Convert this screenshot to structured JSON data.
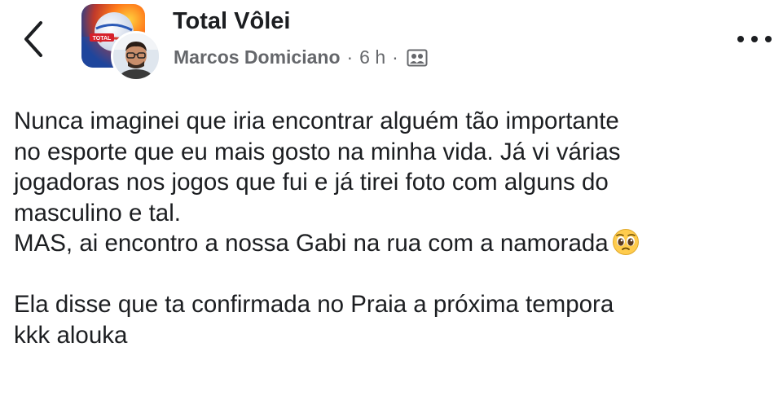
{
  "header": {
    "group_name": "Total Vôlei",
    "author": "Marcos Domiciano",
    "time": "6 h",
    "separator": "·",
    "group_logo_text": "TOTAL"
  },
  "post": {
    "lines_para1": [
      "Nunca imaginei que iria encontrar alguém tão importante",
      "no esporte que eu mais gosto na minha vida. Já vi várias",
      "jogadoras nos jogos que fui e já tirei foto com alguns do",
      "masculino e tal."
    ],
    "line_mas": "MAS, ai encontro a nossa Gabi na rua com a namorada",
    "emoji": "pleading-face-emoji",
    "lines_para2": [
      "Ela disse que ta confirmada no Praia a próxima tempora",
      "kkk alouka"
    ]
  },
  "icons": {
    "back": "chevron-left-icon",
    "more": "more-options-icon",
    "audience": "group-members-icon"
  },
  "colors": {
    "text": "#1c1e21",
    "meta": "#65676b",
    "background": "#ffffff"
  }
}
